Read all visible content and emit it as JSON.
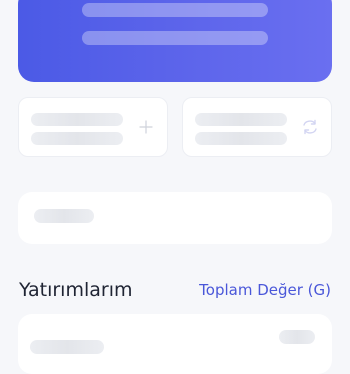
{
  "portfolio": {
    "section_title": "Yatırımlarım",
    "sort_label": "Toplam Değer (G)"
  },
  "actions": [
    {
      "icon": "plus-icon"
    },
    {
      "icon": "swap-icon"
    }
  ],
  "colors": {
    "brand": "#4b5ae6",
    "link": "#4a57d9",
    "background": "#f6f7fa",
    "skeleton": "#e6e8ec"
  }
}
